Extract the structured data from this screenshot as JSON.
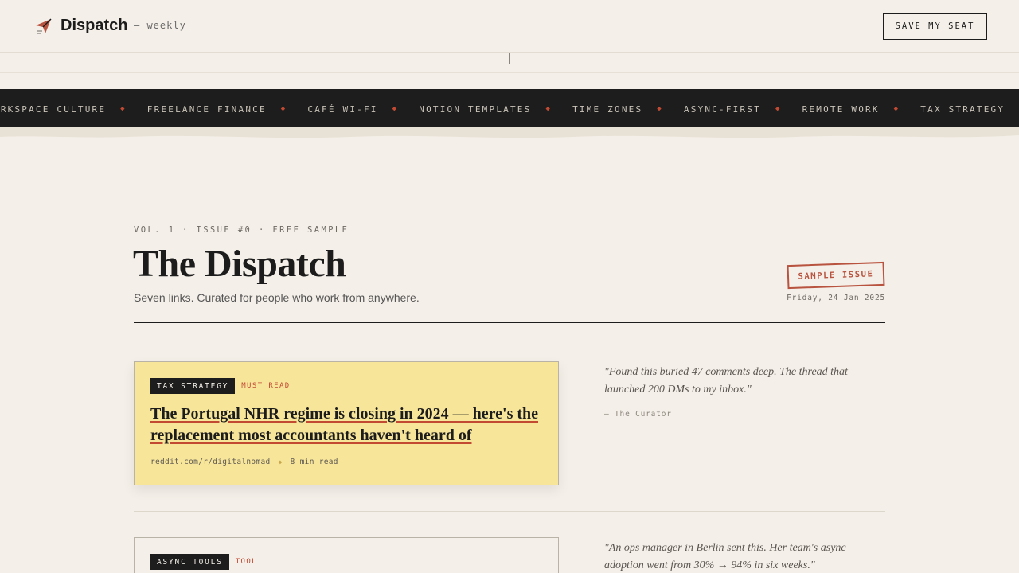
{
  "header": {
    "brand": "Dispatch",
    "brand_sub": "— weekly",
    "cta": "SAVE MY SEAT"
  },
  "ticker": {
    "items": [
      "ORKSPACE CULTURE",
      "FREELANCE FINANCE",
      "CAFÉ WI-FI",
      "NOTION TEMPLATES",
      "TIME ZONES",
      "ASYNC-FIRST",
      "REMOTE WORK",
      "TAX STRATEGY"
    ],
    "separator": "◆"
  },
  "masthead": {
    "issue_meta": "VOL. 1 · ISSUE #0 · FREE SAMPLE",
    "title": "The Dispatch",
    "subtitle": "Seven links. Curated for people who work from anywhere.",
    "stamp": "SAMPLE ISSUE",
    "date": "Friday, 24 Jan 2025"
  },
  "articles": [
    {
      "tag": "TAX STRATEGY",
      "flag": "MUST READ",
      "title": "The Portugal NHR regime is closing in 2024 — here's the replacement most accountants haven't heard of",
      "source": "reddit.com/r/digitalnomad",
      "read_time": "8 min read",
      "quote": "\"Found this buried 47 comments deep. The thread that launched 200 DMs to my inbox.\"",
      "attribution": "— The Curator"
    },
    {
      "tag": "ASYNC TOOLS",
      "flag": "TOOL",
      "quote": "\"An ops manager in Berlin sent this. Her team's async adoption went from 30% → 94% in six weeks.\""
    }
  ],
  "colors": {
    "background": "#f4efe8",
    "ink": "#1c1c1c",
    "accent": "#c24a33",
    "highlight_card": "#f7e59a"
  },
  "icons": {
    "logo": "paper-plane-icon"
  }
}
